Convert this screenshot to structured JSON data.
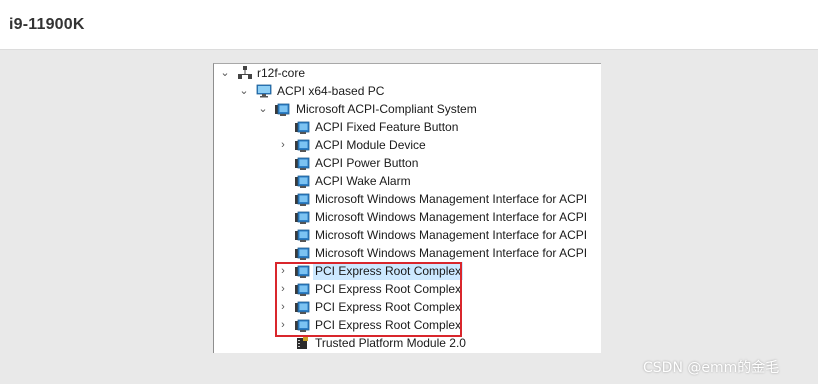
{
  "header": {
    "title": "i9-11900K"
  },
  "tree": {
    "root": "r12f-core",
    "pc": "ACPI x64-based PC",
    "system": "Microsoft ACPI-Compliant System",
    "children": [
      "ACPI Fixed Feature Button",
      "ACPI Module Device",
      "ACPI Power Button",
      "ACPI Wake Alarm",
      "Microsoft Windows Management Interface for ACPI",
      "Microsoft Windows Management Interface for ACPI",
      "Microsoft Windows Management Interface for ACPI",
      "Microsoft Windows Management Interface for ACPI",
      "PCI Express Root Complex",
      "PCI Express Root Complex",
      "PCI Express Root Complex",
      "PCI Express Root Complex",
      "Trusted Platform Module 2.0"
    ]
  },
  "watermark": "CSDN @emm的金毛",
  "colors": {
    "highlight_border": "#d9262c",
    "selection": "#cce8ff"
  }
}
